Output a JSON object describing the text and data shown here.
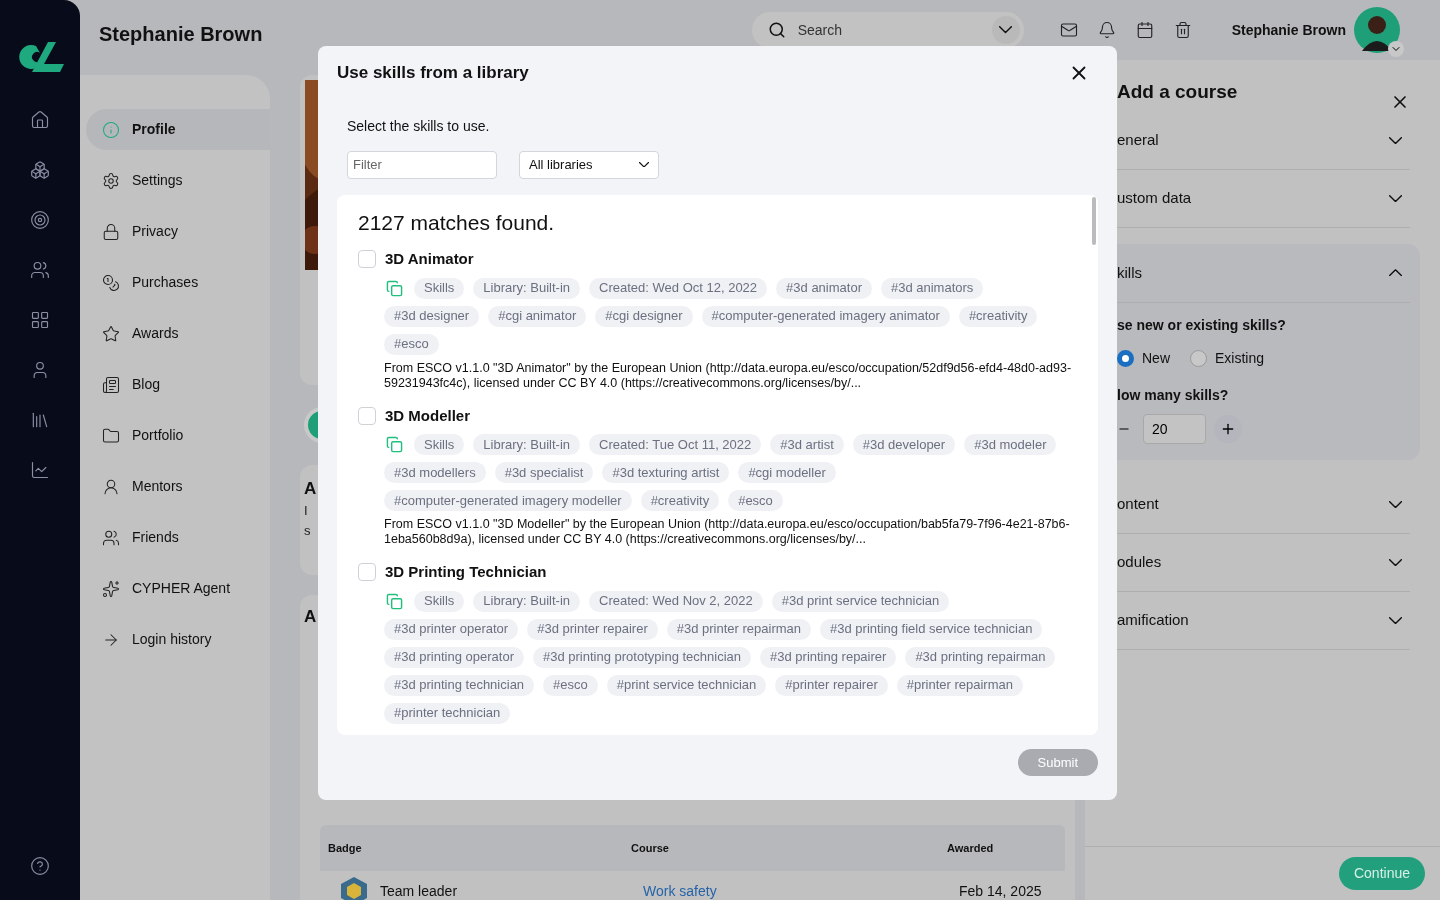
{
  "header": {
    "title": "Stephanie Brown",
    "search": {
      "placeholder": "Search"
    },
    "user_name": "Stephanie Brown"
  },
  "nav": {
    "items": [
      {
        "label": "Profile",
        "selected": true
      },
      {
        "label": "Settings",
        "selected": false
      },
      {
        "label": "Privacy",
        "selected": false
      },
      {
        "label": "Purchases",
        "selected": false
      },
      {
        "label": "Awards",
        "selected": false
      },
      {
        "label": "Blog",
        "selected": false
      },
      {
        "label": "Portfolio",
        "selected": false
      },
      {
        "label": "Mentors",
        "selected": false
      },
      {
        "label": "Friends",
        "selected": false
      },
      {
        "label": "CYPHER Agent",
        "selected": false
      },
      {
        "label": "Login history",
        "selected": false
      }
    ]
  },
  "content": {
    "about_card": {
      "heading": "A",
      "lines": [
        "I",
        "s"
      ]
    },
    "second_card": {
      "heading": "A"
    },
    "table": {
      "columns": [
        "Badge",
        "Course",
        "Awarded"
      ],
      "rows": [
        {
          "badge": "Team leader",
          "course": "Work safety",
          "awarded": "Feb 14, 2025"
        }
      ]
    }
  },
  "drawer": {
    "title": "Add a course",
    "sections": [
      {
        "label": "eneral",
        "expanded": false
      },
      {
        "label": "ustom data",
        "expanded": false
      },
      {
        "label": "kills",
        "expanded": true
      },
      {
        "label": "ontent",
        "expanded": false
      },
      {
        "label": "odules",
        "expanded": false
      },
      {
        "label": "amification",
        "expanded": false
      }
    ],
    "skills_form": {
      "question": "se new or existing skills?",
      "options": [
        {
          "label": "New",
          "selected": true
        },
        {
          "label": "Existing",
          "selected": false
        }
      ],
      "count_label": "low many skills?",
      "count": "20"
    },
    "continue_button": "Continue"
  },
  "modal": {
    "title": "Use skills from a library",
    "instruction": "Select the skills to use.",
    "filter": {
      "placeholder": "Filter"
    },
    "library_select": "All libraries",
    "match_count": "2127 matches found.",
    "skills": [
      {
        "name": "3D Animator",
        "checked": false,
        "tags": [
          "Skills",
          "Library: Built-in",
          "Created: Wed Oct 12, 2022",
          "#3d animator",
          "#3d animators",
          "#3d designer",
          "#cgi animator",
          "#cgi designer",
          "#computer-generated imagery animator",
          "#creativity",
          "#esco"
        ],
        "description": "From ESCO v1.1.0 \"3D Animator\" by the European Union (http://data.europa.eu/esco/occupation/52df9d56-efd4-48d0-ad93-59231943fc4c), licensed under CC BY 4.0 (https://creativecommons.org/licenses/by/..."
      },
      {
        "name": "3D Modeller",
        "checked": false,
        "tags": [
          "Skills",
          "Library: Built-in",
          "Created: Tue Oct 11, 2022",
          "#3d artist",
          "#3d developer",
          "#3d modeler",
          "#3d modellers",
          "#3d specialist",
          "#3d texturing artist",
          "#cgi modeller",
          "#computer-generated imagery modeller",
          "#creativity",
          "#esco"
        ],
        "description": "From ESCO v1.1.0 \"3D Modeller\" by the European Union (http://data.europa.eu/esco/occupation/bab5fa79-7f96-4e21-87b6-1eba560b8d9a), licensed under CC BY 4.0 (https://creativecommons.org/licenses/by/..."
      },
      {
        "name": "3D Printing Technician",
        "checked": false,
        "tags": [
          "Skills",
          "Library: Built-in",
          "Created: Wed Nov 2, 2022",
          "#3d print service technician",
          "#3d printer operator",
          "#3d printer repairer",
          "#3d printer repairman",
          "#3d printing field service technician",
          "#3d printing operator",
          "#3d printing prototyping technician",
          "#3d printing repairer",
          "#3d printing repairman",
          "#3d printing technician",
          "#esco",
          "#print service technician",
          "#printer repairer",
          "#printer repairman",
          "#printer technician"
        ]
      }
    ],
    "submit": {
      "label": "Submit",
      "disabled": true
    }
  }
}
